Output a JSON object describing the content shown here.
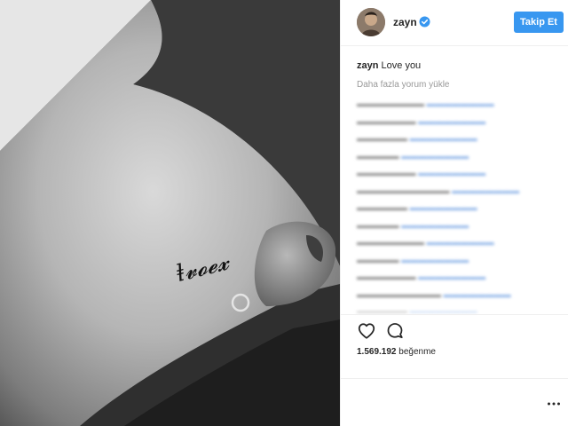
{
  "post": {
    "username": "zayn",
    "follow_label": "Takip Et",
    "caption_user": "zayn",
    "caption_text": "Love you",
    "load_more": "Daha fazla yorum yükle",
    "likes_count": "1.569.192",
    "likes_label": "beğenme"
  },
  "colors": {
    "accent": "#3897f0",
    "verified": "#3897f0",
    "hashtag": "#8fb4e8",
    "muted": "#999999"
  },
  "icons": {
    "like": "heart-outline-icon",
    "comment": "speech-bubble-icon",
    "verified": "verified-badge-icon",
    "more": "ellipsis-icon"
  }
}
